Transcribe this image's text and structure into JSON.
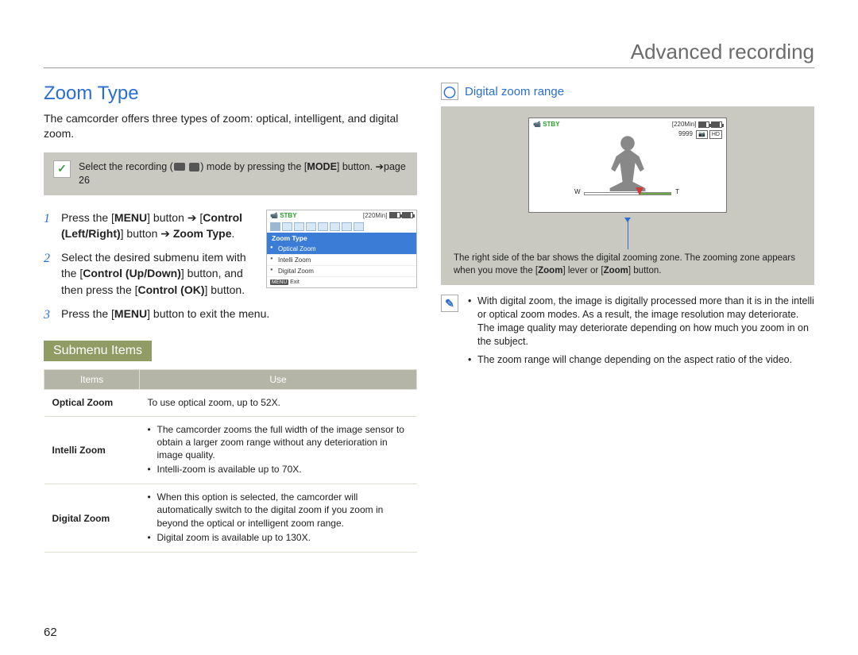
{
  "section_title": "Advanced recording",
  "page_number": "62",
  "heading": "Zoom Type",
  "intro": "The camcorder offers three types of zoom: optical, intelligent, and digital zoom.",
  "mode_note": {
    "pre": "Select the recording (",
    "post": ") mode by pressing the [",
    "mode_label": "MODE",
    "tail": "] button. ➔page 26"
  },
  "steps": {
    "s1": {
      "a": "Press the [",
      "menu": "MENU",
      "b": "] button ➔ [",
      "ctrl": "Control (Left/Right)",
      "c": "] button ➔ ",
      "zt": "Zoom Type",
      "d": "."
    },
    "s2": {
      "a": "Select the desired submenu item with the [",
      "ud": "Control (Up/Down)",
      "b": "] button, and then press the [",
      "ok": "Control (OK)",
      "c": "] button."
    },
    "s3": {
      "a": "Press the [",
      "menu": "MENU",
      "b": "] button to exit the menu."
    }
  },
  "lcd": {
    "stby": "STBY",
    "time": "[220Min]",
    "title": "Zoom Type",
    "items": [
      "Optical Zoom",
      "Intelli Zoom",
      "Digital Zoom"
    ],
    "menu_btn": "MENU",
    "exit": "Exit"
  },
  "submenu_label": "Submenu Items",
  "table": {
    "h1": "Items",
    "h2": "Use",
    "rows": [
      {
        "name": "Optical Zoom",
        "use": "To use optical zoom, up to 52X."
      },
      {
        "name": "Intelli Zoom",
        "use_list": [
          "The camcorder zooms the full width of the image sensor to obtain a larger zoom range without any deterioration in image quality.",
          "Intelli-zoom is available up to 70X."
        ]
      },
      {
        "name": "Digital Zoom",
        "use_list": [
          "When this option is selected, the camcorder will automatically switch to the digital zoom if you zoom in beyond the optical or intelligent zoom range.",
          "Digital zoom is available up to 130X."
        ]
      }
    ]
  },
  "right": {
    "heading": "Digital zoom range",
    "preview": {
      "stby": "STBY",
      "time": "[220Min]",
      "count": "9999",
      "hd": "HD",
      "w": "W",
      "t": "T"
    },
    "caption": {
      "a": "The right side of the bar shows the digital zooming zone. The zooming zone appears when you move the [",
      "z": "Zoom",
      "b": "] lever or [",
      "z2": "Zoom",
      "c": "] button."
    },
    "notes": [
      "With digital zoom, the image is digitally processed more than it is in the intelli or optical zoom modes. As a result, the image resolution may deteriorate. The image quality may deteriorate depending on how much you zoom in on the subject.",
      "The zoom range will change depending on the aspect ratio of the video."
    ]
  }
}
